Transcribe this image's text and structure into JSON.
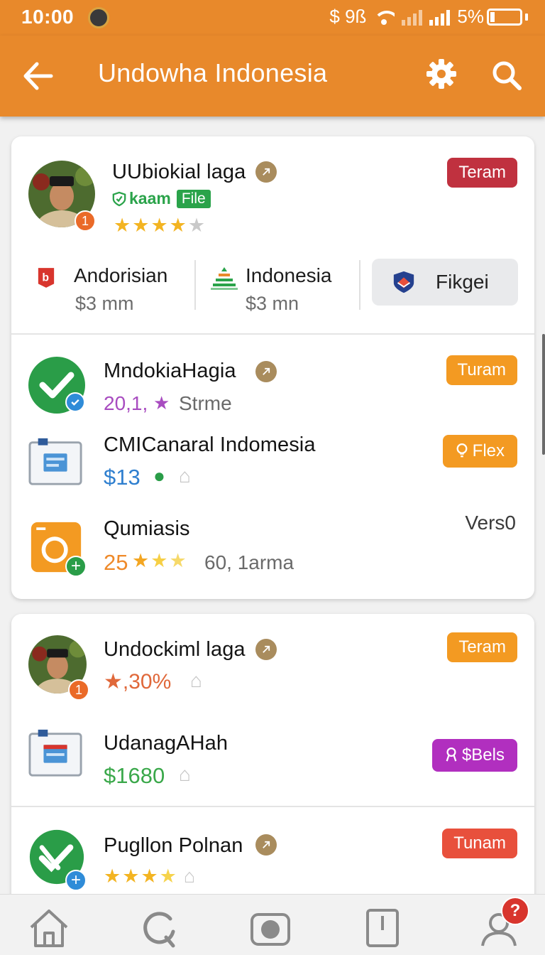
{
  "status": {
    "time": "10:00",
    "indicators": "$ 9ß",
    "battery": "5%"
  },
  "appbar": {
    "title": "Undowha Indonesia",
    "back_icon": "arrow-left-icon",
    "settings_icon": "gear-icon",
    "search_icon": "search-icon"
  },
  "card1": {
    "profile": {
      "name": "UUbiokial laga",
      "tag_label": "kaam",
      "tag_file": "File",
      "badge": "Teram",
      "notif_count": "1",
      "rating": 4
    },
    "stats": [
      {
        "label": "Andorisian",
        "value": "$3 mm"
      },
      {
        "label": "Indonesia",
        "value": "$3 mn"
      }
    ],
    "action_button": "Fikgei",
    "items": [
      {
        "name": "MndokiaHagia",
        "meta_num": "20,1,",
        "meta_text": "Strme",
        "badge": "Turam"
      },
      {
        "name": "CMICanaral Indomesia",
        "price": "$13",
        "badge": "Flex"
      },
      {
        "name": "Qumiasis",
        "score": "25",
        "meta_text": "60, 1arma",
        "version": "Vers0"
      }
    ]
  },
  "card2": {
    "items": [
      {
        "name": "Undockiml laga",
        "meta": "★,30%",
        "badge": "Teram",
        "notif_count": "1"
      },
      {
        "name": "UdanagAHah",
        "price": "$1680",
        "badge": "$Bels"
      },
      {
        "name": "Pugllon Polnan",
        "badge": "Tunam",
        "rating": 4
      }
    ]
  },
  "nav": {
    "items": [
      "home-icon",
      "refresh-icon",
      "camera-icon",
      "book-icon",
      "profile-icon"
    ],
    "profile_badge": "?"
  },
  "colors": {
    "primary": "#e8892b",
    "red_badge": "#c0313f",
    "orange_badge": "#f39a22",
    "purple_badge": "#b12fbf",
    "coral_badge": "#e8503c"
  }
}
